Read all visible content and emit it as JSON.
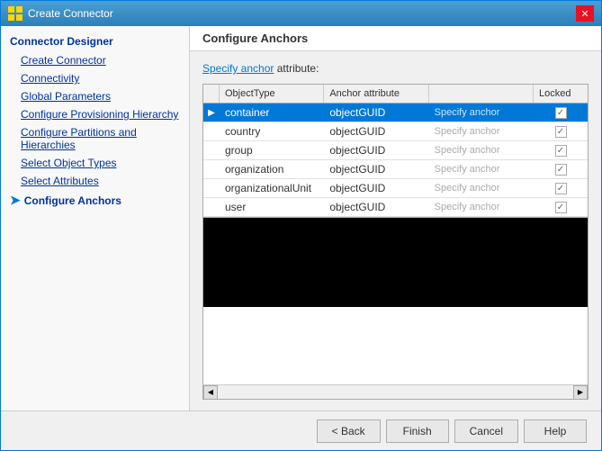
{
  "window": {
    "title": "Create Connector",
    "icon": "⚙"
  },
  "sidebar": {
    "header": "Connector Designer",
    "items": [
      {
        "id": "create-connector",
        "label": "Create Connector",
        "indent": true,
        "active": false
      },
      {
        "id": "connectivity",
        "label": "Connectivity",
        "indent": true,
        "active": false
      },
      {
        "id": "global-parameters",
        "label": "Global Parameters",
        "indent": true,
        "active": false
      },
      {
        "id": "configure-provisioning",
        "label": "Configure Provisioning Hierarchy",
        "indent": true,
        "active": false
      },
      {
        "id": "configure-partitions",
        "label": "Configure Partitions and Hierarchies",
        "indent": true,
        "active": false
      },
      {
        "id": "select-object-types",
        "label": "Select Object Types",
        "indent": true,
        "active": false
      },
      {
        "id": "select-attributes",
        "label": "Select Attributes",
        "indent": true,
        "active": false
      },
      {
        "id": "configure-anchors",
        "label": "Configure Anchors",
        "indent": true,
        "active": true,
        "arrow": true
      }
    ]
  },
  "panel": {
    "header": "Configure Anchors",
    "specify_text_prefix": "Specify anchor",
    "specify_text_suffix": " attribute:",
    "table": {
      "columns": [
        {
          "id": "selector",
          "label": ""
        },
        {
          "id": "object-type",
          "label": "ObjectType"
        },
        {
          "id": "anchor-attribute",
          "label": "Anchor attribute"
        },
        {
          "id": "specify",
          "label": ""
        },
        {
          "id": "locked",
          "label": "Locked"
        }
      ],
      "rows": [
        {
          "id": "container",
          "object_type": "container",
          "anchor_attribute": "objectGUID",
          "specify_label": "Specify anchor",
          "locked": true,
          "selected": true
        },
        {
          "id": "country",
          "object_type": "country",
          "anchor_attribute": "objectGUID",
          "specify_label": "Specify anchor",
          "locked": true,
          "selected": false
        },
        {
          "id": "group",
          "object_type": "group",
          "anchor_attribute": "objectGUID",
          "specify_label": "Specify anchor",
          "locked": true,
          "selected": false
        },
        {
          "id": "organization",
          "object_type": "organization",
          "anchor_attribute": "objectGUID",
          "specify_label": "Specify anchor",
          "locked": true,
          "selected": false
        },
        {
          "id": "organizational-unit",
          "object_type": "organizationalUnit",
          "anchor_attribute": "objectGUID",
          "specify_label": "Specify anchor",
          "locked": true,
          "selected": false
        },
        {
          "id": "user",
          "object_type": "user",
          "anchor_attribute": "objectGUID",
          "specify_label": "Specify anchor",
          "locked": true,
          "selected": false
        }
      ]
    }
  },
  "footer": {
    "back_label": "< Back",
    "finish_label": "Finish",
    "cancel_label": "Cancel",
    "help_label": "Help"
  }
}
